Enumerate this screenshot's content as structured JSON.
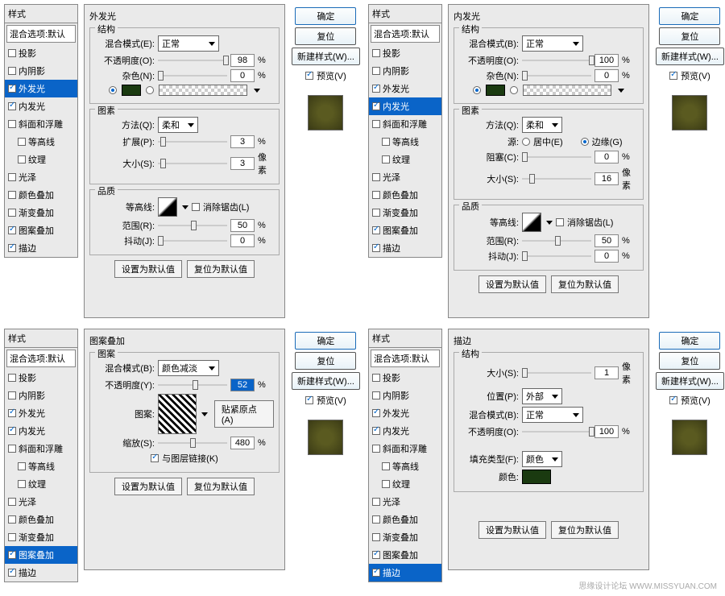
{
  "common": {
    "styles_header": "样式",
    "blend_opts": "混合选项:默认",
    "items": [
      "投影",
      "内阴影",
      "外发光",
      "内发光",
      "斜面和浮雕",
      "等高线",
      "纹理",
      "光泽",
      "颜色叠加",
      "渐变叠加",
      "图案叠加",
      "描边"
    ],
    "ok": "确定",
    "reset": "复位",
    "new_style": "新建样式(W)...",
    "preview": "预览(V)",
    "set_default": "设置为默认值",
    "reset_default": "复位为默认值",
    "blend_mode": "混合模式",
    "opacity": "不透明度",
    "noise": "杂色",
    "method": "方法",
    "spread": "扩展",
    "size": "大小",
    "choke": "阻塞",
    "contour": "等高线",
    "antialias": "消除锯齿",
    "range": "范围",
    "jitter": "抖动",
    "struct": "结构",
    "elements": "图素",
    "quality": "品质",
    "pct": "%",
    "px": "像素",
    "source": "源",
    "center": "居中",
    "edge": "边缘"
  },
  "p1": {
    "title": "外发光",
    "mode": "正常",
    "opacity": "98",
    "noise": "0",
    "method": "柔和",
    "spread": "3",
    "size": "3",
    "range": "50",
    "jitter": "0"
  },
  "p2": {
    "title": "内发光",
    "mode": "正常",
    "opacity": "100",
    "noise": "0",
    "method": "柔和",
    "choke": "0",
    "size": "16",
    "range": "50",
    "jitter": "0"
  },
  "p3": {
    "title": "图案叠加",
    "legend": "图案",
    "mode": "颜色减淡",
    "opacity": "52",
    "scale": "480",
    "pattern": "图案:",
    "snap": "贴紧原点(A)",
    "scale_lbl": "缩放(S):",
    "link": "与图层链接(K)"
  },
  "p4": {
    "title": "描边",
    "size": "1",
    "pos_lbl": "位置(P):",
    "pos": "外部",
    "mode": "正常",
    "opacity": "100",
    "fill_type_lbl": "填充类型(F):",
    "fill_type": "颜色",
    "color_lbl": "颜色:"
  },
  "watermark": "思缘设计论坛   WWW.MISSYUAN.COM"
}
